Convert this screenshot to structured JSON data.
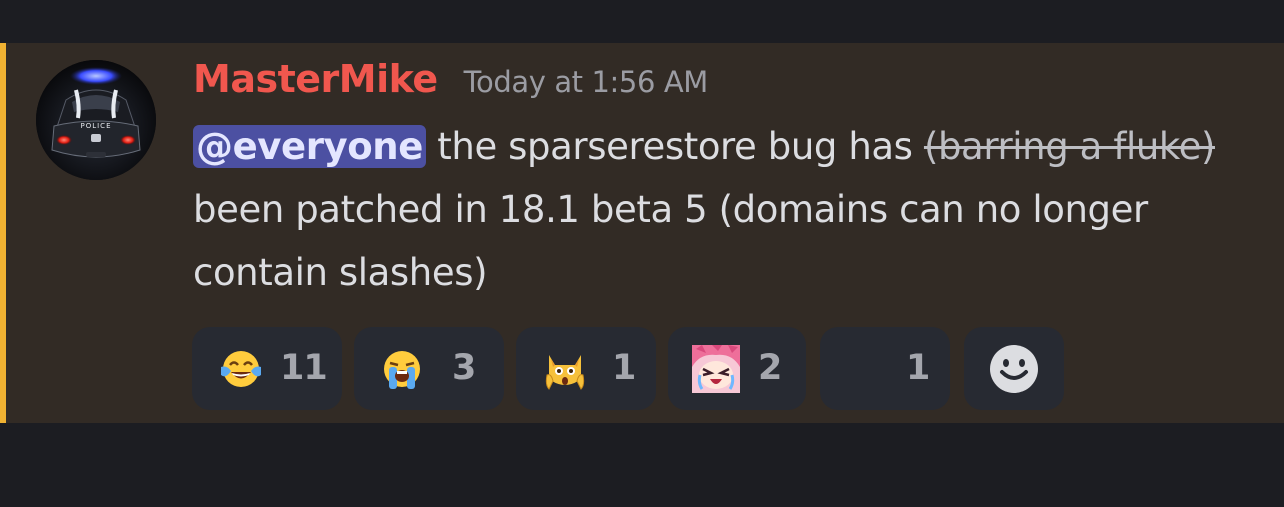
{
  "message": {
    "author": "MasterMike",
    "timestamp": "Today at 1:56 AM",
    "author_color": "#f0574e",
    "mention_bar_color": "#f0b232",
    "avatar_icon": "police-car-avatar",
    "avatar_badge_text": "POLICE",
    "content": {
      "mention": "@everyone",
      "text_1": " the sparserestore bug has ",
      "strikethrough": "(barring a fluke)",
      "text_2": " been patched in 18.1 beta 5 (domains can no longer contain slashes)"
    }
  },
  "reactions": [
    {
      "icon": "face-with-tears-of-joy-icon",
      "count": "11"
    },
    {
      "icon": "loudly-crying-face-icon",
      "count": "3"
    },
    {
      "icon": "weary-cat-icon",
      "count": "1"
    },
    {
      "icon": "crying-anime-girl-icon",
      "count": "2"
    },
    {
      "icon": "blank-emoji-icon",
      "count": "1"
    }
  ],
  "add_reaction": {
    "icon": "add-reaction-smiley-icon"
  }
}
